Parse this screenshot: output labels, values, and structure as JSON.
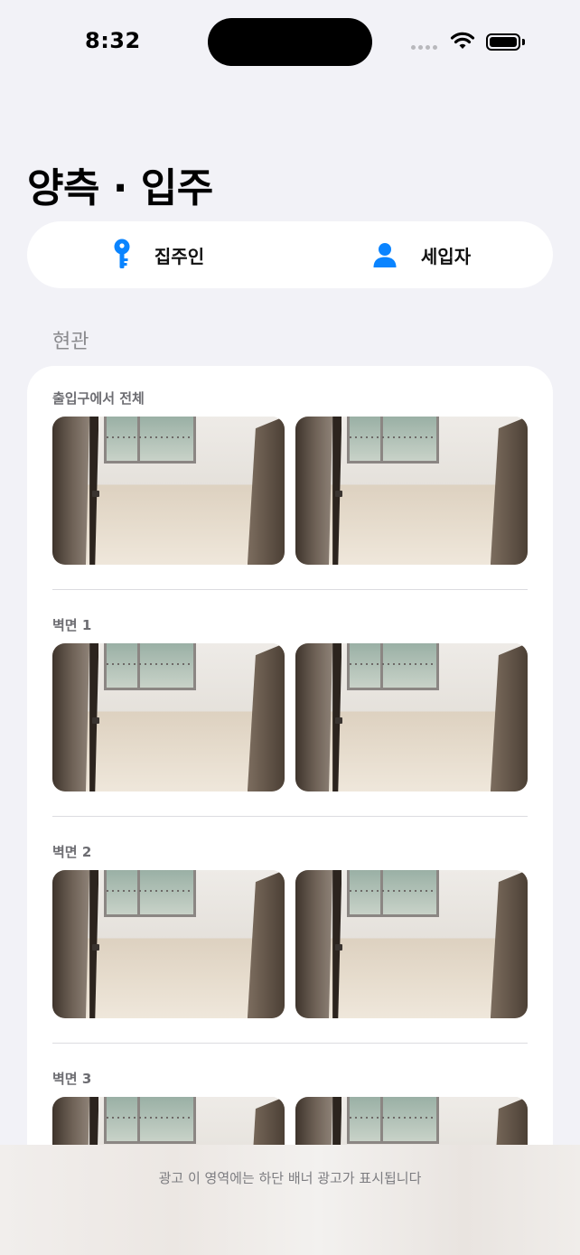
{
  "status_bar": {
    "time": "8:32"
  },
  "page_title": "양측 · 입주",
  "segmented": {
    "items": [
      {
        "label": "집주인",
        "icon": "key-icon",
        "color": "#0a84ff"
      },
      {
        "label": "세입자",
        "icon": "person-icon",
        "color": "#0a84ff"
      }
    ]
  },
  "section": {
    "title": "현관",
    "groups": [
      {
        "label": "출입구에서 전체"
      },
      {
        "label": "벽면 1"
      },
      {
        "label": "벽면 2"
      },
      {
        "label": "벽면 3"
      }
    ]
  },
  "ad_banner": {
    "text": "광고   이 영역에는 하단 배너 광고가 표시됩니다"
  }
}
